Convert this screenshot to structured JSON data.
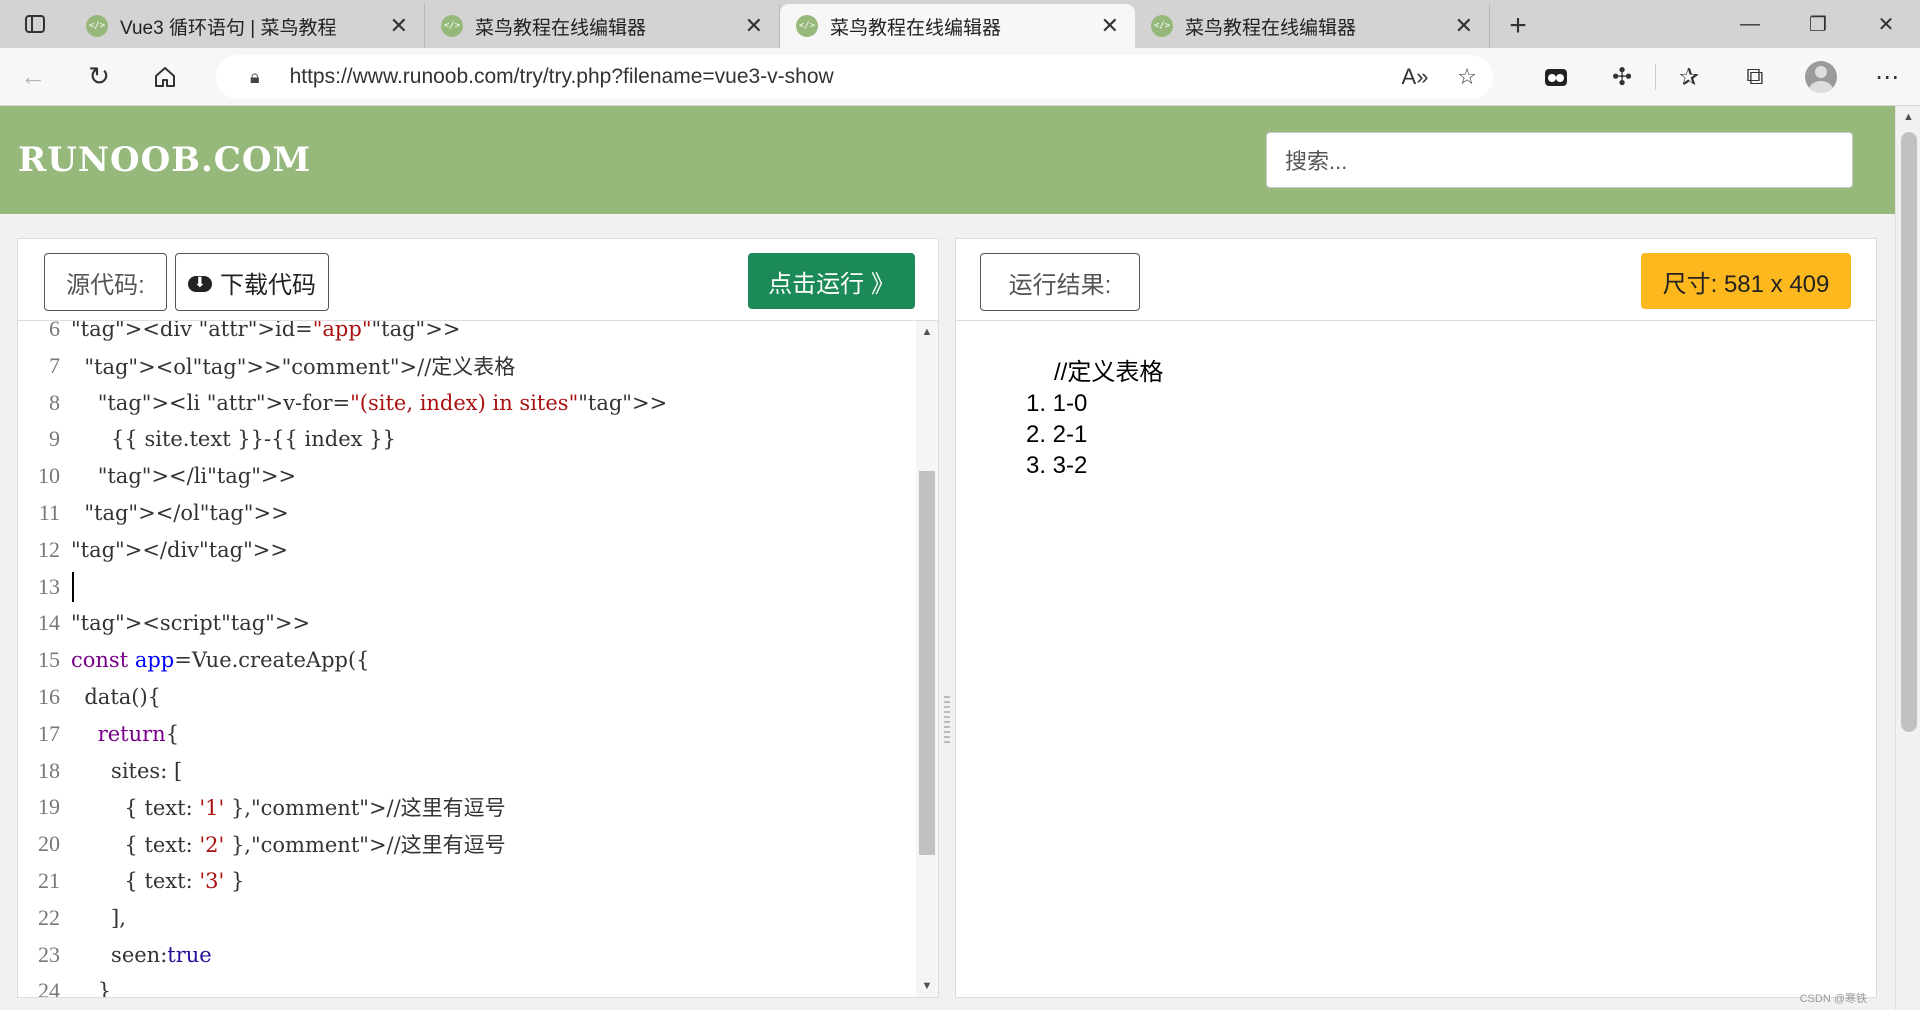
{
  "tabs": [
    {
      "title": "Vue3 循环语句 | 菜鸟教程",
      "active": false
    },
    {
      "title": "菜鸟教程在线编辑器",
      "active": false
    },
    {
      "title": "菜鸟教程在线编辑器",
      "active": true
    },
    {
      "title": "菜鸟教程在线编辑器",
      "active": false
    }
  ],
  "address": {
    "url": "https://www.runoob.com/try/try.php?filename=vue3-v-show"
  },
  "site": {
    "logo": "RUNOOB.COM",
    "search_placeholder": "搜索..."
  },
  "editor_panel": {
    "source_label": "源代码:",
    "download_label": "下载代码",
    "run_label": "点击运行 》"
  },
  "result_panel": {
    "result_label": "运行结果:",
    "size_label": "尺寸: 581 x 409",
    "output_text": "//定义表格",
    "output_items": [
      "1. 1-0",
      "2. 2-1",
      "3. 3-2"
    ]
  },
  "code_lines": [
    {
      "num": "6",
      "text": "<div id=\"app\">"
    },
    {
      "num": "7",
      "text": "  <ol>//定义表格"
    },
    {
      "num": "8",
      "text": "    <li v-for=\"(site, index) in sites\">"
    },
    {
      "num": "9",
      "text": "      {{ site.text }}-{{ index }}"
    },
    {
      "num": "10",
      "text": "    </li>"
    },
    {
      "num": "11",
      "text": "  </ol>"
    },
    {
      "num": "12",
      "text": "</div>"
    },
    {
      "num": "13",
      "text": ""
    },
    {
      "num": "14",
      "text": "<script>"
    },
    {
      "num": "15",
      "text": "const app=Vue.createApp({"
    },
    {
      "num": "16",
      "text": "  data(){"
    },
    {
      "num": "17",
      "text": "    return{"
    },
    {
      "num": "18",
      "text": "      sites: ["
    },
    {
      "num": "19",
      "text": "        { text: '1' },//这里有逗号"
    },
    {
      "num": "20",
      "text": "        { text: '2' },//这里有逗号"
    },
    {
      "num": "21",
      "text": "        { text: '3' }"
    },
    {
      "num": "22",
      "text": "      ],"
    },
    {
      "num": "23",
      "text": "      seen:true"
    },
    {
      "num": "24",
      "text": "    }"
    }
  ],
  "watermark": "CSDN @寒铁",
  "colors": {
    "header_green": "#96b97b",
    "run_button": "#1c8a58",
    "size_badge": "#fdb81d"
  }
}
